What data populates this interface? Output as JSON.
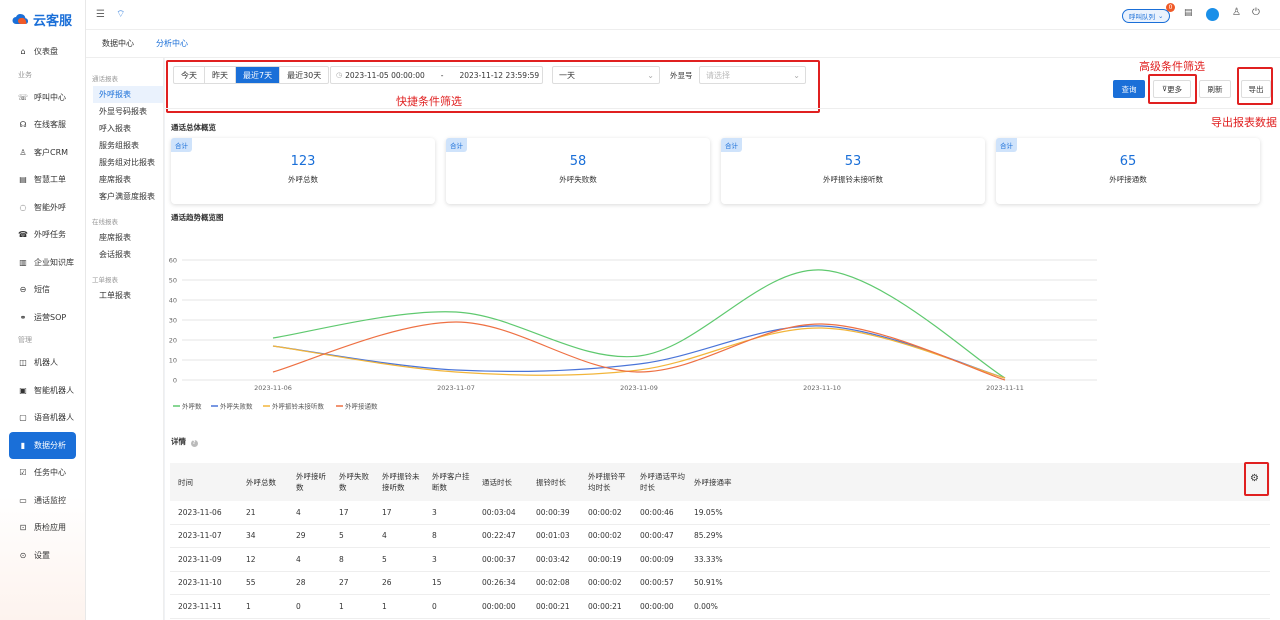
{
  "app": {
    "name": "云客服"
  },
  "sidebar": {
    "groups": [
      "业务",
      "管理"
    ],
    "items": [
      {
        "label": "仪表盘",
        "icon": "home-icon"
      },
      {
        "label": "呼叫中心",
        "icon": "phone-icon"
      },
      {
        "label": "在线客服",
        "icon": "headset-icon"
      },
      {
        "label": "客户CRM",
        "icon": "user-icon"
      },
      {
        "label": "智慧工单",
        "icon": "document-icon"
      },
      {
        "label": "智能外呼",
        "icon": "chat-icon"
      },
      {
        "label": "外呼任务",
        "icon": "call-out-icon"
      },
      {
        "label": "企业知识库",
        "icon": "book-icon"
      },
      {
        "label": "短信",
        "icon": "message-icon"
      },
      {
        "label": "运营SOP",
        "icon": "flow-icon"
      },
      {
        "label": "机器人",
        "icon": "robot-icon"
      },
      {
        "label": "智能机器人",
        "icon": "ai-robot-icon"
      },
      {
        "label": "语音机器人",
        "icon": "voice-robot-icon"
      },
      {
        "label": "数据分析",
        "icon": "chart-icon"
      },
      {
        "label": "任务中心",
        "icon": "task-icon"
      },
      {
        "label": "通话监控",
        "icon": "monitor-icon"
      },
      {
        "label": "质检应用",
        "icon": "quality-icon"
      },
      {
        "label": "设置",
        "icon": "settings-icon"
      }
    ]
  },
  "topbar": {
    "queue_label": "呼叫队列",
    "badge": "0"
  },
  "tabs": [
    {
      "label": "数据中心"
    },
    {
      "label": "分析中心"
    }
  ],
  "subnav": {
    "groups": [
      "通话报表",
      "在线报表",
      "工单报表"
    ],
    "call_items": [
      "外呼报表",
      "外显号码报表",
      "呼入报表",
      "服务组报表",
      "服务组对比报表",
      "座席报表",
      "客户满意度报表"
    ],
    "online_items": [
      "座席报表",
      "会话报表"
    ],
    "ticket_items": [
      "工单报表"
    ]
  },
  "filters": {
    "quick": [
      "今天",
      "昨天",
      "最近7天",
      "最近30天"
    ],
    "date_start": "2023-11-05 00:00:00",
    "date_sep": "-",
    "date_end": "2023-11-12 23:59:59",
    "granularity": "一天",
    "caller_label": "外显号",
    "caller_placeholder": "请选择",
    "query": "查询",
    "more": "更多",
    "refresh": "刷新",
    "export": "导出"
  },
  "annotations": {
    "quick": "快捷条件筛选",
    "advanced": "高级条件筛选",
    "export": "导出报表数据"
  },
  "overview": {
    "title": "通话总体概览",
    "cards": [
      {
        "badge": "合计",
        "value": "123",
        "label": "外呼总数"
      },
      {
        "badge": "合计",
        "value": "58",
        "label": "外呼失败数"
      },
      {
        "badge": "合计",
        "value": "53",
        "label": "外呼振铃未接听数"
      },
      {
        "badge": "合计",
        "value": "65",
        "label": "外呼接通数"
      }
    ]
  },
  "trend": {
    "title": "通话趋势概览图"
  },
  "chart_data": {
    "type": "line",
    "x": [
      "2023-11-06",
      "2023-11-07",
      "2023-11-09",
      "2023-11-10",
      "2023-11-11"
    ],
    "yticks": [
      0,
      10,
      20,
      30,
      40,
      50,
      60
    ],
    "ylim": [
      0,
      60
    ],
    "grid": true,
    "legend": "bottom-left",
    "series": [
      {
        "name": "外呼数",
        "color": "#5fc96f",
        "values": [
          21,
          34,
          12,
          55,
          1
        ]
      },
      {
        "name": "外呼失败数",
        "color": "#4a74d8",
        "values": [
          17,
          5,
          8,
          27,
          1
        ]
      },
      {
        "name": "外呼振铃未接听数",
        "color": "#f2b53a",
        "values": [
          17,
          4,
          5,
          26,
          1
        ]
      },
      {
        "name": "外呼接通数",
        "color": "#ee7043",
        "values": [
          4,
          29,
          4,
          28,
          0
        ]
      }
    ]
  },
  "details": {
    "title": "详情",
    "columns": [
      "时间",
      "外呼总数",
      "外呼接听数",
      "外呼失败数",
      "外呼振铃未接听数",
      "外呼客户挂断数",
      "通话时长",
      "振铃时长",
      "外呼振铃平均时长",
      "外呼通话平均时长",
      "外呼接通率"
    ],
    "rows": [
      [
        "2023-11-06",
        "21",
        "4",
        "17",
        "17",
        "3",
        "00:03:04",
        "00:00:39",
        "00:00:02",
        "00:00:46",
        "19.05%"
      ],
      [
        "2023-11-07",
        "34",
        "29",
        "5",
        "4",
        "8",
        "00:22:47",
        "00:01:03",
        "00:00:02",
        "00:00:47",
        "85.29%"
      ],
      [
        "2023-11-09",
        "12",
        "4",
        "8",
        "5",
        "3",
        "00:00:37",
        "00:03:42",
        "00:00:19",
        "00:00:09",
        "33.33%"
      ],
      [
        "2023-11-10",
        "55",
        "28",
        "27",
        "26",
        "15",
        "00:26:34",
        "00:02:08",
        "00:00:02",
        "00:00:57",
        "50.91%"
      ],
      [
        "2023-11-11",
        "1",
        "0",
        "1",
        "1",
        "0",
        "00:00:00",
        "00:00:21",
        "00:00:21",
        "00:00:00",
        "0.00%"
      ]
    ]
  }
}
